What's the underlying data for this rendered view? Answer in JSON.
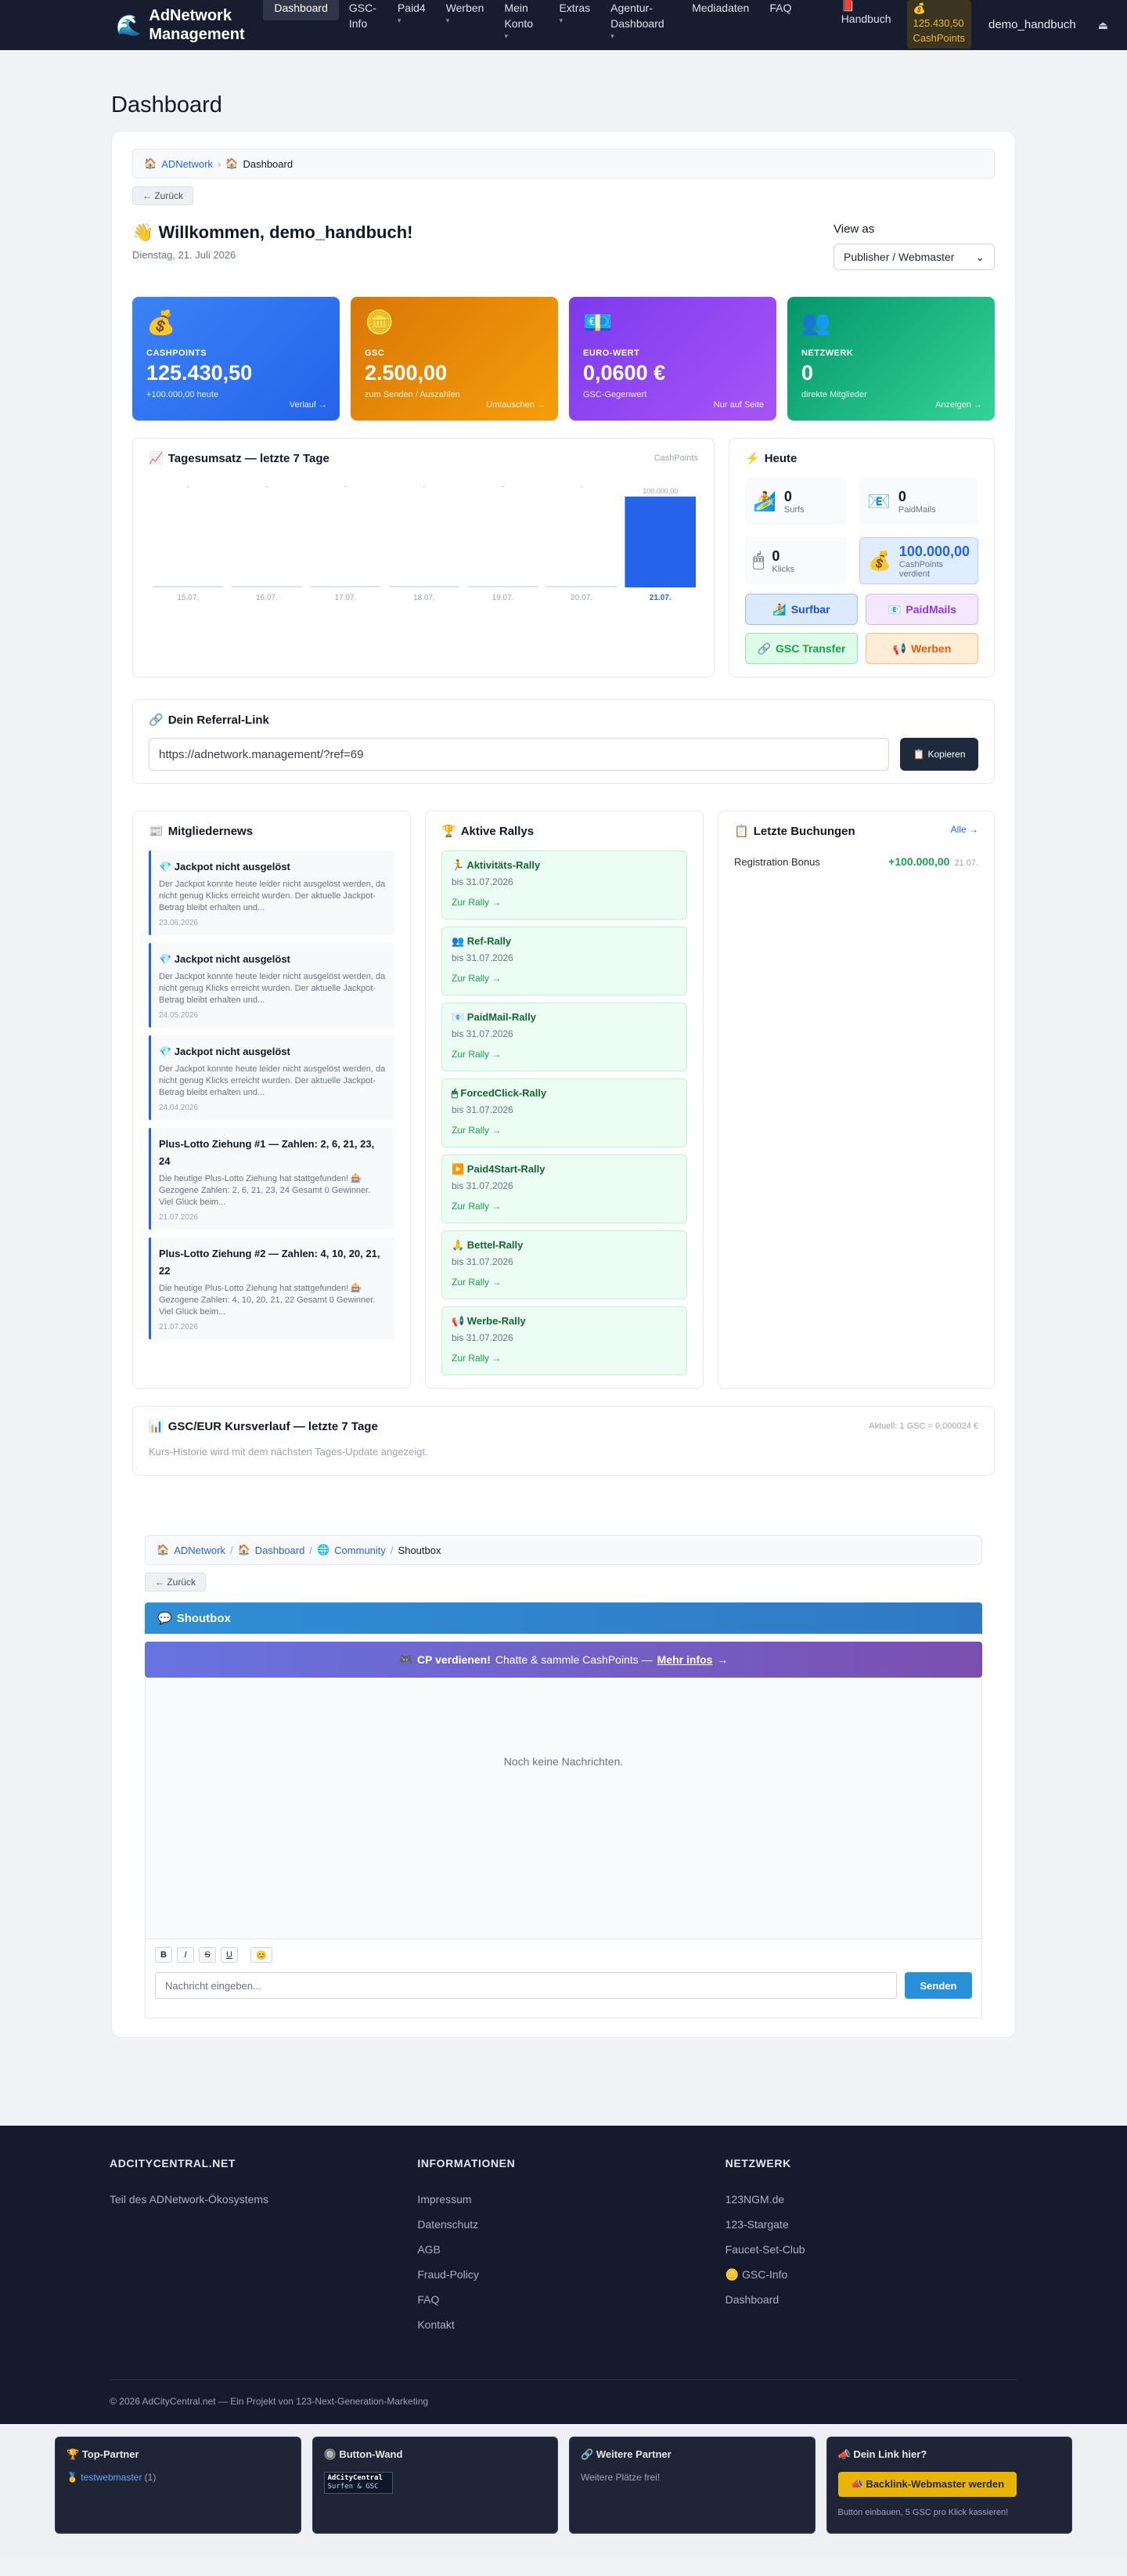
{
  "nav": {
    "brand": "AdNetwork Management",
    "items": [
      {
        "label": "Dashboard",
        "caret": ""
      },
      {
        "label": "GSC-Info",
        "caret": ""
      },
      {
        "label": "Paid4",
        "caret": "▾"
      },
      {
        "label": "Werben",
        "caret": "▾"
      },
      {
        "label": "Mein Konto",
        "caret": "▾"
      },
      {
        "label": "Extras",
        "caret": "▾"
      },
      {
        "label": "Agentur-Dashboard",
        "caret": "▾"
      },
      {
        "label": "Mediadaten",
        "caret": ""
      },
      {
        "label": "FAQ",
        "caret": ""
      }
    ],
    "handbuch": "Handbuch",
    "cashpoints_value": "125.430,50",
    "cashpoints_label": "CashPoints",
    "username": "demo_handbuch"
  },
  "page_title": "Dashboard",
  "breadcrumb": {
    "root": "ADNetwork",
    "current": "Dashboard"
  },
  "back_label": "← Zurück",
  "welcome": {
    "title": "Willkommen, demo_handbuch!",
    "date": "Dienstag, 21. Juli 2026"
  },
  "view_as": {
    "label": "View as",
    "selected": "Publisher / Webmaster"
  },
  "stats": [
    {
      "label": "CASHPOINTS",
      "value": "125.430,50",
      "sub": "+100.000,00 heute",
      "link": "Verlauf →"
    },
    {
      "label": "GSC",
      "value": "2.500,00",
      "sub": "zum Senden / Auszahlen",
      "link": "Umtauschen →"
    },
    {
      "label": "EURO-WERT",
      "value": "0,0600 €",
      "sub": "GSC-Gegenwert",
      "link": "Nur auf Seite"
    },
    {
      "label": "NETZWERK",
      "value": "0",
      "sub": "direkte Mitglieder",
      "link": "Anzeigen →"
    }
  ],
  "chart_data": {
    "type": "bar",
    "title": "Tagesumsatz — letzte 7 Tage",
    "unit": "CashPoints",
    "categories": [
      "15.07.",
      "16.07.",
      "17.07.",
      "18.07.",
      "19.07.",
      "20.07.",
      "21.07."
    ],
    "values": [
      0,
      0,
      0,
      0,
      0,
      0,
      100000
    ],
    "value_labels": [
      "-",
      "-",
      "-",
      "-",
      "-",
      "-",
      "100.000,00"
    ]
  },
  "today": {
    "title": "Heute",
    "cells": [
      {
        "value": "0",
        "label": "Surfs"
      },
      {
        "value": "0",
        "label": "PaidMails"
      },
      {
        "value": "0",
        "label": "Klicks"
      },
      {
        "value": "100.000,00",
        "label": "CashPoints verdient"
      }
    ],
    "buttons": [
      "Surfbar",
      "PaidMails",
      "GSC Transfer",
      "Werben"
    ]
  },
  "referral": {
    "title": "Dein Referral-Link",
    "url": "https://adnetwork.management/?ref=69",
    "copy": "Kopieren"
  },
  "news": {
    "title": "Mitgliedernews",
    "items": [
      {
        "title": "💎 Jackpot nicht ausgelöst",
        "body": "Der Jackpot konnte heute leider nicht ausgelöst werden, da nicht genug Klicks erreicht wurden. Der aktuelle Jackpot-Betrag bleibt erhalten und...",
        "date": "23.06.2026"
      },
      {
        "title": "💎 Jackpot nicht ausgelöst",
        "body": "Der Jackpot konnte heute leider nicht ausgelöst werden, da nicht genug Klicks erreicht wurden. Der aktuelle Jackpot-Betrag bleibt erhalten und...",
        "date": "24.05.2026"
      },
      {
        "title": "💎 Jackpot nicht ausgelöst",
        "body": "Der Jackpot konnte heute leider nicht ausgelöst werden, da nicht genug Klicks erreicht wurden. Der aktuelle Jackpot-Betrag bleibt erhalten und...",
        "date": "24.04.2026"
      },
      {
        "title": "Plus-Lotto Ziehung #1 — Zahlen: 2, 6, 21, 23, 24",
        "body": "Die heutige Plus-Lotto Ziehung hat stattgefunden! 🎰 Gezogene Zahlen: 2, 6, 21, 23, 24 Gesamt 0 Gewinner. Viel Glück beim...",
        "date": "21.07.2026"
      },
      {
        "title": "Plus-Lotto Ziehung #2 — Zahlen: 4, 10, 20, 21, 22",
        "body": "Die heutige Plus-Lotto Ziehung hat stattgefunden! 🎰 Gezogene Zahlen: 4, 10, 20, 21, 22 Gesamt 0 Gewinner. Viel Glück beim...",
        "date": "21.07.2026"
      }
    ]
  },
  "rallies": {
    "title": "Aktive Rallys",
    "link": "Zur Rally →",
    "items": [
      {
        "name": "🏃 Aktivitäts-Rally",
        "until": "bis 31.07.2026"
      },
      {
        "name": "👥 Ref-Rally",
        "until": "bis 31.07.2026"
      },
      {
        "name": "📧 PaidMail-Rally",
        "until": "bis 31.07.2026"
      },
      {
        "name": "🖱 ForcedClick-Rally",
        "until": "bis 31.07.2026"
      },
      {
        "name": "▶️ Paid4Start-Rally",
        "until": "bis 31.07.2026"
      },
      {
        "name": "🙏 Bettel-Rally",
        "until": "bis 31.07.2026"
      },
      {
        "name": "📢 Werbe-Rally",
        "until": "bis 31.07.2026"
      }
    ]
  },
  "bookings": {
    "title": "Letzte Buchungen",
    "all": "Alle →",
    "rows": [
      {
        "label": "Registration Bonus",
        "amount": "+100.000,00",
        "date": "21.07."
      }
    ]
  },
  "gsc": {
    "title": "GSC/EUR Kursverlauf — letzte 7 Tage",
    "current": "Aktuell: 1 GSC = 0,000024 €",
    "note": "Kurs-Historie wird mit dem nächsten Tages-Update angezeigt."
  },
  "shout": {
    "breadcrumb": [
      "ADNetwork",
      "Dashboard",
      "Community",
      "Shoutbox"
    ],
    "title": "Shoutbox",
    "promo_bold": "CP verdienen!",
    "promo_text": "Chatte & sammle CashPoints —",
    "promo_link": "Mehr infos",
    "empty": "Noch keine Nachrichten.",
    "placeholder": "Nachricht eingeben...",
    "send": "Senden"
  },
  "footer": {
    "col1": {
      "title": "ADCITYCENTRAL.NET",
      "text": "Teil des ADNetwork-Ökosystems"
    },
    "col2": {
      "title": "INFORMATIONEN",
      "links": [
        "Impressum",
        "Datenschutz",
        "AGB",
        "Fraud-Policy",
        "FAQ",
        "Kontakt"
      ]
    },
    "col3": {
      "title": "NETZWERK",
      "links": [
        "123NGM.de",
        "123-Stargate",
        "Faucet-Set-Club",
        "🪙 GSC-Info",
        "Dashboard"
      ]
    },
    "copyright": "© 2026 AdCityCentral.net — Ein Projekt von 123-Next-Generation-Marketing"
  },
  "partners": {
    "top": {
      "title": "Top-Partner",
      "name": "testwebmaster",
      "count": "(1)"
    },
    "wall": {
      "title": "Button-Wand",
      "banner1": "AdCityCentral",
      "banner2": "Surfen & GSC"
    },
    "more": {
      "title": "Weitere Partner",
      "text": "Weitere Plätze frei!"
    },
    "here": {
      "title": "Dein Link hier?",
      "button": "Backlink-Webmaster werden",
      "note": "Button einbauen, 5 GSC pro Klick kassieren!"
    }
  }
}
